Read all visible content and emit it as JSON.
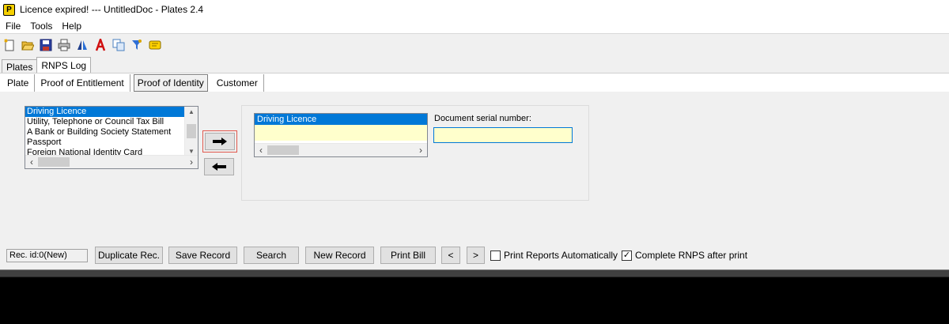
{
  "window": {
    "title": "Licence expired! --- UntitledDoc - Plates 2.4",
    "app_icon_letter": "P"
  },
  "menu": [
    "File",
    "Tools",
    "Help"
  ],
  "toolbar_icons": [
    "new-icon",
    "open-folder-icon",
    "save-icon",
    "print-icon",
    "compare-icon",
    "font-icon",
    "copy-icon",
    "filter-icon",
    "message-icon"
  ],
  "main_tabs": [
    {
      "label": "Plates",
      "active": false
    },
    {
      "label": "RNPS Log",
      "active": true
    }
  ],
  "sub_tabs": [
    {
      "label": "Plate",
      "active": false
    },
    {
      "label": "Proof of Entitlement",
      "active": false
    },
    {
      "label": "Proof of Identity",
      "active": true
    },
    {
      "label": "Customer",
      "active": false
    }
  ],
  "available_documents": [
    "Driving Licence",
    "Utility, Telephone or Council Tax Bill",
    "A Bank or Building Society Statement",
    "Passport",
    "Foreign National Identity Card"
  ],
  "selected_available_index": 0,
  "selected_documents": [
    "Driving Licence"
  ],
  "serial": {
    "label": "Document serial number:",
    "value": ""
  },
  "status": {
    "rec_id": "Rec. id:0(New)",
    "buttons": {
      "duplicate": "Duplicate Rec.",
      "save": "Save Record",
      "search": "Search",
      "new": "New Record",
      "print": "Print Bill",
      "prev": "<",
      "next": ">"
    },
    "print_reports": {
      "label": "Print Reports Automatically",
      "checked": false
    },
    "complete_rnps": {
      "label": "Complete RNPS after print",
      "checked": true
    }
  },
  "colors": {
    "selection": "#0078d7",
    "input_bg": "#ffffcc",
    "focus_ring": "#e0584d"
  }
}
